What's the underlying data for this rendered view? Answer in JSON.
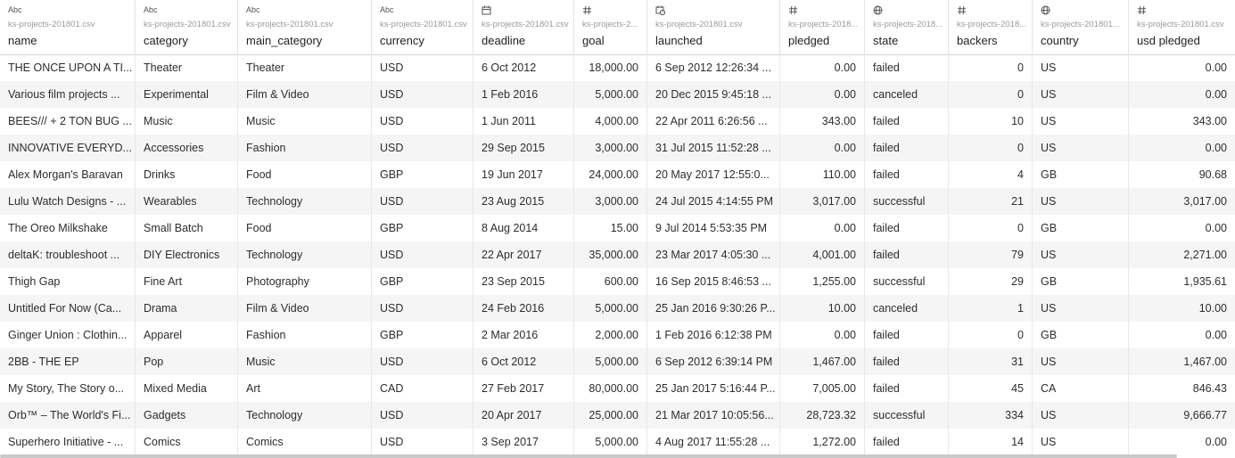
{
  "columns": [
    {
      "type_icon": "abc",
      "type_label": "Abc",
      "source": "ks-projects-201801.csv",
      "name": "name",
      "align": "left"
    },
    {
      "type_icon": "abc",
      "type_label": "Abc",
      "source": "ks-projects-201801.csv",
      "name": "category",
      "align": "left"
    },
    {
      "type_icon": "abc",
      "type_label": "Abc",
      "source": "ks-projects-201801.csv",
      "name": "main_category",
      "align": "left"
    },
    {
      "type_icon": "abc",
      "type_label": "Abc",
      "source": "ks-projects-201801.csv",
      "name": "currency",
      "align": "left"
    },
    {
      "type_icon": "calendar",
      "type_label": "",
      "source": "ks-projects-201801.csv",
      "name": "deadline",
      "align": "left"
    },
    {
      "type_icon": "hash",
      "type_label": "",
      "source": "ks-projects-2...",
      "name": "goal",
      "align": "right"
    },
    {
      "type_icon": "datetime",
      "type_label": "",
      "source": "ks-projects-201801.csv",
      "name": "launched",
      "align": "left"
    },
    {
      "type_icon": "hash",
      "type_label": "",
      "source": "ks-projects-2018...",
      "name": "pledged",
      "align": "right"
    },
    {
      "type_icon": "globe",
      "type_label": "",
      "source": "ks-projects-2018...",
      "name": "state",
      "align": "left"
    },
    {
      "type_icon": "hash",
      "type_label": "",
      "source": "ks-projects-2018...",
      "name": "backers",
      "align": "right"
    },
    {
      "type_icon": "globe",
      "type_label": "",
      "source": "ks-projects-201801...",
      "name": "country",
      "align": "left"
    },
    {
      "type_icon": "hash",
      "type_label": "",
      "source": "ks-projects-201801.csv",
      "name": "usd pledged",
      "align": "right"
    }
  ],
  "rows": [
    [
      "THE ONCE UPON A TI...",
      "Theater",
      "Theater",
      "USD",
      "6 Oct 2012",
      "18,000.00",
      "6 Sep 2012 12:26:34 ...",
      "0.00",
      "failed",
      "0",
      "US",
      "0.00"
    ],
    [
      "Various film projects ...",
      "Experimental",
      "Film & Video",
      "USD",
      "1 Feb 2016",
      "5,000.00",
      "20 Dec 2015 9:45:18 ...",
      "0.00",
      "canceled",
      "0",
      "US",
      "0.00"
    ],
    [
      "BEES/// + 2 TON BUG ...",
      "Music",
      "Music",
      "USD",
      "1 Jun 2011",
      "4,000.00",
      "22 Apr 2011 6:26:56 ...",
      "343.00",
      "failed",
      "10",
      "US",
      "343.00"
    ],
    [
      "INNOVATIVE EVERYD...",
      "Accessories",
      "Fashion",
      "USD",
      "29 Sep 2015",
      "3,000.00",
      "31 Jul 2015 11:52:28 ...",
      "0.00",
      "failed",
      "0",
      "US",
      "0.00"
    ],
    [
      "Alex Morgan's Baravan",
      "Drinks",
      "Food",
      "GBP",
      "19 Jun 2017",
      "24,000.00",
      "20 May 2017 12:55:0...",
      "110.00",
      "failed",
      "4",
      "GB",
      "90.68"
    ],
    [
      "Lulu Watch Designs - ...",
      "Wearables",
      "Technology",
      "USD",
      "23 Aug 2015",
      "3,000.00",
      "24 Jul 2015 4:14:55 PM",
      "3,017.00",
      "successful",
      "21",
      "US",
      "3,017.00"
    ],
    [
      "The Oreo Milkshake",
      "Small Batch",
      "Food",
      "GBP",
      "8 Aug 2014",
      "15.00",
      "9 Jul 2014 5:53:35 PM",
      "0.00",
      "failed",
      "0",
      "GB",
      "0.00"
    ],
    [
      "deltaK: troubleshoot ...",
      "DIY Electronics",
      "Technology",
      "USD",
      "22 Apr 2017",
      "35,000.00",
      "23 Mar 2017 4:05:30 ...",
      "4,001.00",
      "failed",
      "79",
      "US",
      "2,271.00"
    ],
    [
      "Thigh Gap",
      "Fine Art",
      "Photography",
      "GBP",
      "23 Sep 2015",
      "600.00",
      "16 Sep 2015 8:46:53 ...",
      "1,255.00",
      "successful",
      "29",
      "GB",
      "1,935.61"
    ],
    [
      "Untitled For Now (Ca...",
      "Drama",
      "Film & Video",
      "USD",
      "24 Feb 2016",
      "5,000.00",
      "25 Jan 2016 9:30:26 P...",
      "10.00",
      "canceled",
      "1",
      "US",
      "10.00"
    ],
    [
      "Ginger Union : Clothin...",
      "Apparel",
      "Fashion",
      "GBP",
      "2 Mar 2016",
      "2,000.00",
      "1 Feb 2016 6:12:38 PM",
      "0.00",
      "failed",
      "0",
      "GB",
      "0.00"
    ],
    [
      "2BB - THE EP",
      "Pop",
      "Music",
      "USD",
      "6 Oct 2012",
      "5,000.00",
      "6 Sep 2012 6:39:14 PM",
      "1,467.00",
      "failed",
      "31",
      "US",
      "1,467.00"
    ],
    [
      "My Story, The Story o...",
      "Mixed Media",
      "Art",
      "CAD",
      "27 Feb 2017",
      "80,000.00",
      "25 Jan 2017 5:16:44 P...",
      "7,005.00",
      "failed",
      "45",
      "CA",
      "846.43"
    ],
    [
      "Orb™ – The World's Fi...",
      "Gadgets",
      "Technology",
      "USD",
      "20 Apr 2017",
      "25,000.00",
      "21 Mar 2017 10:05:56...",
      "28,723.32",
      "successful",
      "334",
      "US",
      "9,666.77"
    ],
    [
      "Superhero Initiative - ...",
      "Comics",
      "Comics",
      "USD",
      "3 Sep 2017",
      "5,000.00",
      "4 Aug 2017 11:55:28 ...",
      "1,272.00",
      "failed",
      "14",
      "US",
      "0.00"
    ]
  ]
}
